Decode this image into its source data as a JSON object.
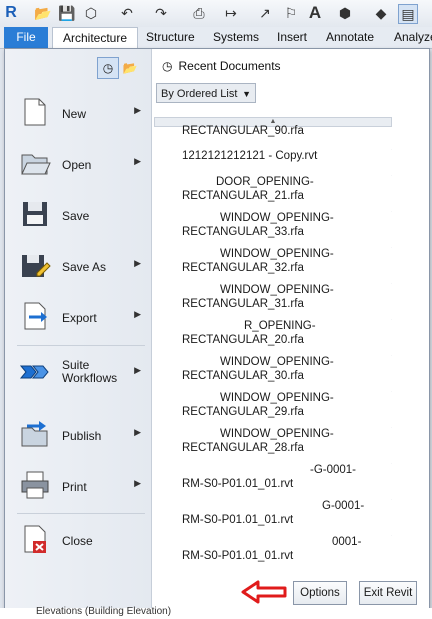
{
  "ribbon": {
    "tabs": [
      "File",
      "Architecture",
      "Structure",
      "Systems",
      "Insert",
      "Annotate",
      "Analyze"
    ],
    "active_tab": "Architecture"
  },
  "quick_access": {
    "icons": [
      "revit-logo",
      "open-icon",
      "save-icon",
      "sync-icon",
      "undo-icon",
      "redo-icon",
      "print-icon",
      "measure-icon",
      "dimension-icon",
      "tag-icon",
      "text-icon",
      "3d-view-icon",
      "section-icon",
      "switch-windows-icon"
    ],
    "text_tool_label": "A"
  },
  "app_menu": {
    "left_items": [
      {
        "label": "New",
        "has_submenu": true,
        "icon": "new-document-icon"
      },
      {
        "label": "Open",
        "has_submenu": true,
        "icon": "open-folder-icon"
      },
      {
        "label": "Save",
        "has_submenu": false,
        "icon": "save-icon"
      },
      {
        "label": "Save As",
        "has_submenu": true,
        "icon": "save-as-icon"
      },
      {
        "label": "Export",
        "has_submenu": true,
        "icon": "export-icon"
      },
      {
        "label": "Suite Workflows",
        "has_submenu": true,
        "icon": "suite-workflows-icon"
      },
      {
        "label": "Publish",
        "has_submenu": true,
        "icon": "publish-icon"
      },
      {
        "label": "Print",
        "has_submenu": true,
        "icon": "print-icon"
      },
      {
        "label": "Close",
        "has_submenu": false,
        "icon": "close-document-icon"
      }
    ],
    "recent": {
      "title": "Recent Documents",
      "sort_by": "By Ordered List",
      "documents": [
        [
          "RECTANGULAR_90.rfa"
        ],
        [
          "1212121212121 - Copy.rvt"
        ],
        [
          "DOOR_OPENING-",
          "RECTANGULAR_21.rfa"
        ],
        [
          "WINDOW_OPENING-",
          "RECTANGULAR_33.rfa"
        ],
        [
          "WINDOW_OPENING-",
          "RECTANGULAR_32.rfa"
        ],
        [
          "WINDOW_OPENING-",
          "RECTANGULAR_31.rfa"
        ],
        [
          "R_OPENING-",
          "RECTANGULAR_20.rfa"
        ],
        [
          "WINDOW_OPENING-",
          "RECTANGULAR_30.rfa"
        ],
        [
          "WINDOW_OPENING-",
          "RECTANGULAR_29.rfa"
        ],
        [
          "WINDOW_OPENING-",
          "RECTANGULAR_28.rfa"
        ],
        [
          "-G-0001-",
          "RM-S0-P01.01_01.rvt"
        ],
        [
          "G-0001-",
          "RM-S0-P01.01_01.rvt"
        ],
        [
          "0001-",
          "RM-S0-P01.01_01.rvt"
        ]
      ]
    },
    "options_label": "Options",
    "exit_label": "Exit Revit"
  },
  "background": {
    "project_browser_text": "Elevations (Building Elevation)"
  },
  "colors": {
    "file_tab": "#2a7dd6",
    "annotation_arrow": "#e01b1b"
  }
}
